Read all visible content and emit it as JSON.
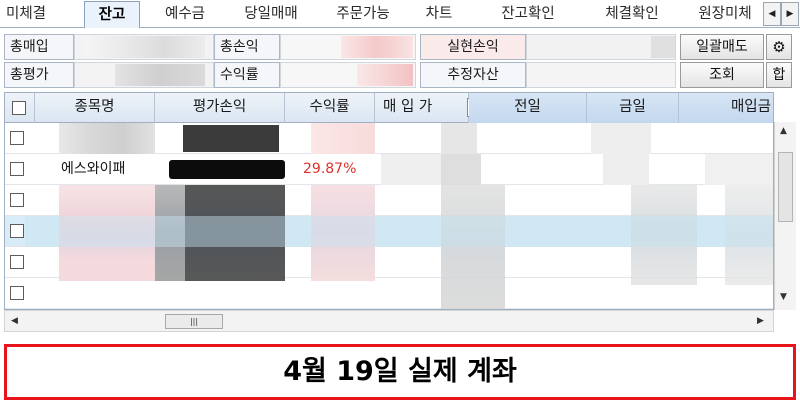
{
  "tabs": [
    {
      "label": "미체결",
      "active": false
    },
    {
      "label": "잔고",
      "active": true
    },
    {
      "label": "예수금",
      "active": false
    },
    {
      "label": "당일매매",
      "active": false
    },
    {
      "label": "주문가능",
      "active": false
    },
    {
      "label": "차트",
      "active": false
    },
    {
      "label": "잔고확인",
      "active": false
    },
    {
      "label": "체결확인",
      "active": false
    },
    {
      "label": "원장미체",
      "active": false
    }
  ],
  "tab_nav": {
    "prev": "◀",
    "next": "▶"
  },
  "summary": {
    "total_buy_label": "총매입",
    "total_eval_label": "총평가",
    "total_pl_label": "총손익",
    "return_label": "수익률",
    "realized_pl_label": "실현손익",
    "est_asset_label": "추정자산",
    "sell_all_button": "일괄매도",
    "query_button": "조회",
    "sum_button": "합",
    "gear_icon": "⚙"
  },
  "grid": {
    "columns": [
      "종목명",
      "평가손익",
      "수익률",
      "매 입 가",
      "전일",
      "금일",
      "매입금"
    ],
    "dropdown_glyph": "▼",
    "visible_row": {
      "stock_name": "에스와이패",
      "return_rate": "29.87%"
    },
    "selected_row_index": 3
  },
  "scroll": {
    "up": "▲",
    "down": "▼",
    "left": "◀",
    "right": "▶",
    "grip": "|||"
  },
  "caption": "4월 19일 실제 계좌",
  "colors": {
    "accent_red": "#e8141c",
    "profit_red": "#e0302a",
    "selected_row": "#d7ecf6",
    "header_blue": "#c3d7ee"
  }
}
